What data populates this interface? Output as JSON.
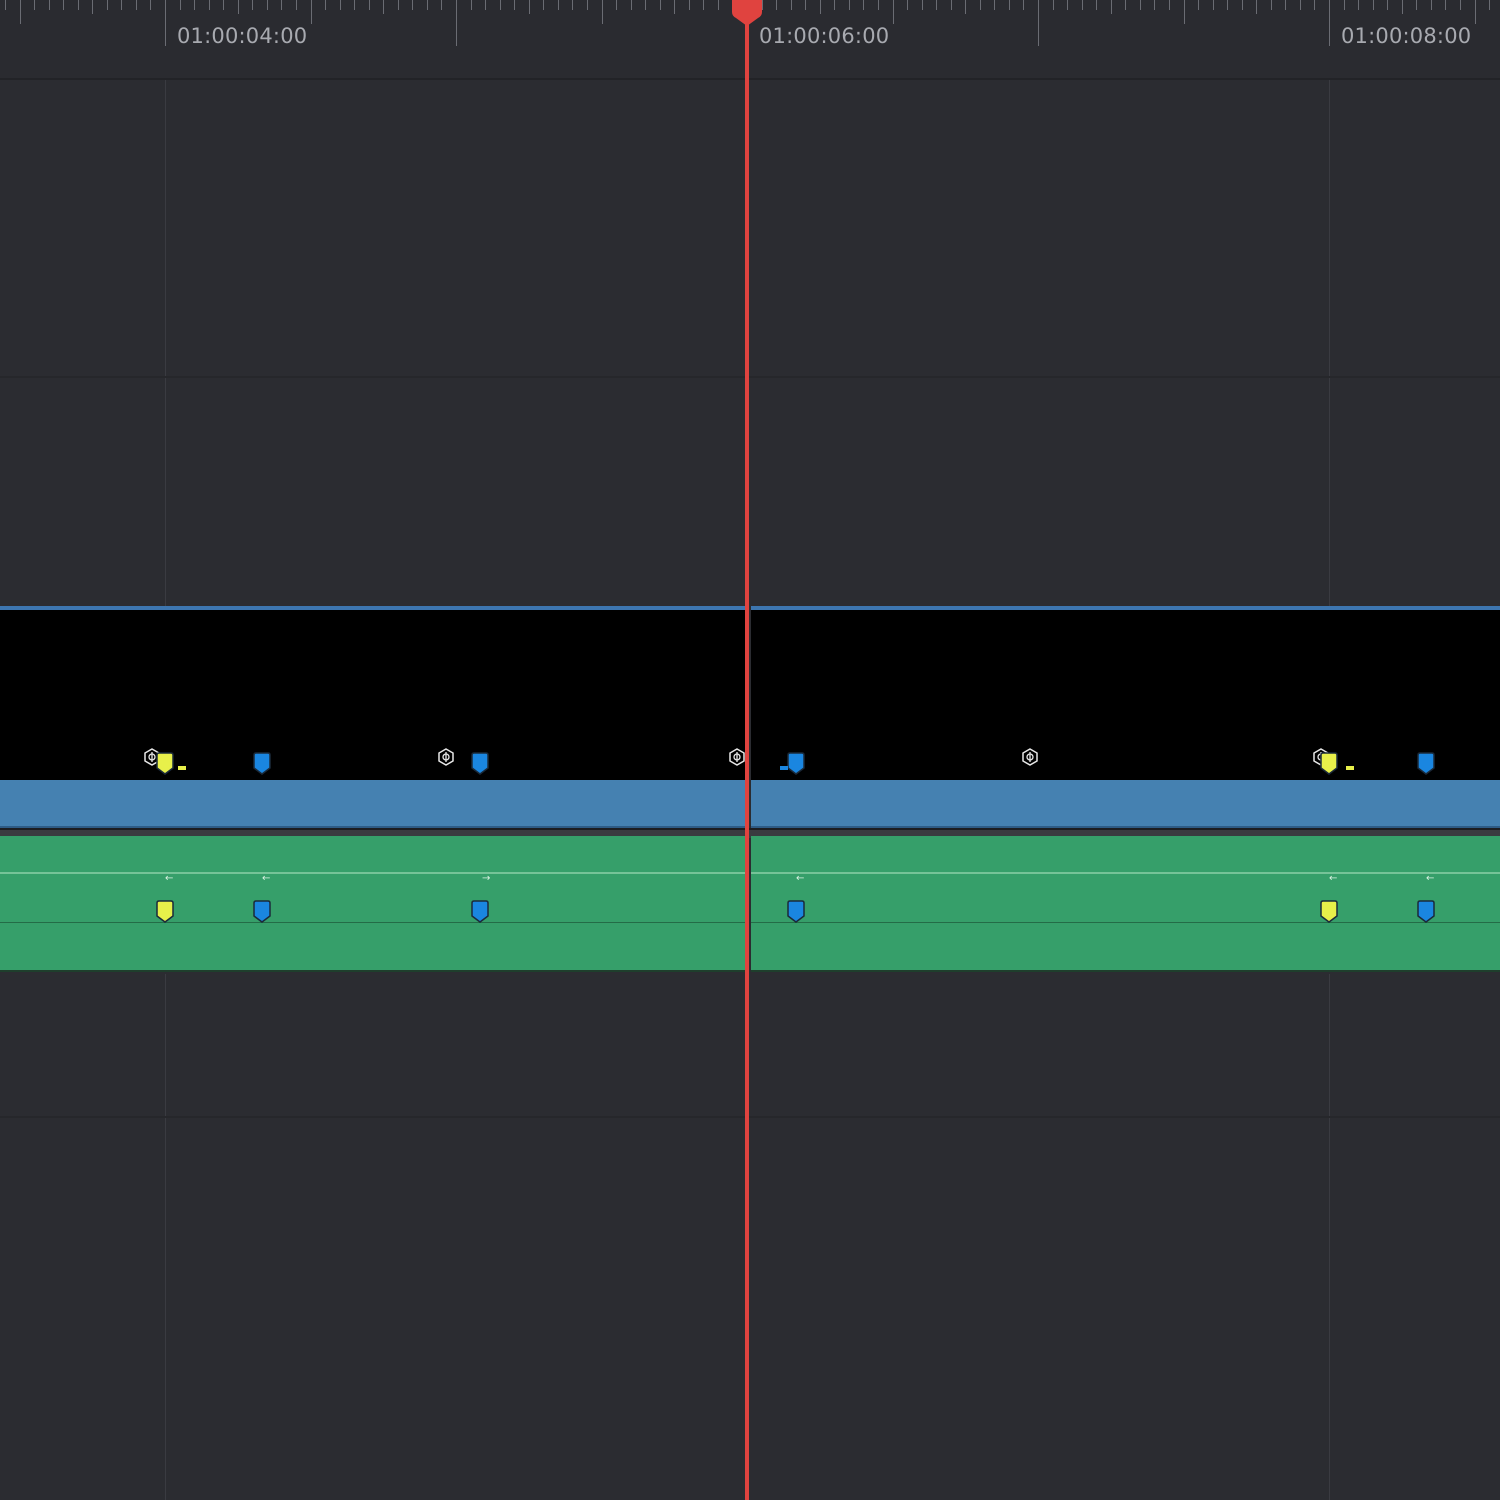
{
  "ruler": {
    "labels": [
      {
        "text": "01:00:04:00"
      },
      {
        "text": "01:00:06:00"
      },
      {
        "text": "01:00:08:00"
      }
    ]
  },
  "colors": {
    "background": "#2b2c31",
    "playhead": "#e0433f",
    "video_clip": "#000000",
    "video_bar": "#4581b1",
    "audio_clip": "#369f6a",
    "marker_yellow": "#e8f04a",
    "marker_blue": "#1a86e0"
  },
  "icons": {
    "clip_retime": "retime-icon",
    "marker": "marker-icon"
  }
}
